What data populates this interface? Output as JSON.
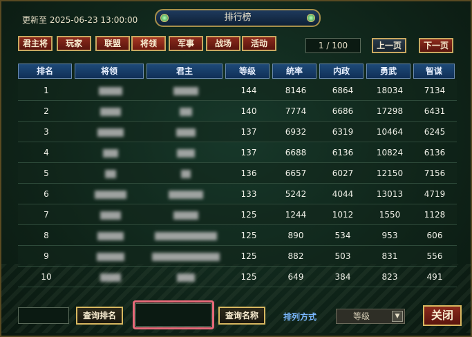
{
  "header": {
    "update_label": "更新至",
    "update_time": "2025-06-23 13:00:00",
    "title": "排行榜"
  },
  "tabs": [
    {
      "label": "君主将",
      "active": false
    },
    {
      "label": "玩家",
      "active": false
    },
    {
      "label": "联盟",
      "active": false
    },
    {
      "label": "将领",
      "active": true
    },
    {
      "label": "军事",
      "active": false
    },
    {
      "label": "战场",
      "active": false
    },
    {
      "label": "活动",
      "active": false
    }
  ],
  "pagination": {
    "page_text": "1 / 100",
    "prev_label": "上一页",
    "next_label": "下一页"
  },
  "table": {
    "columns": [
      "排名",
      "将领",
      "君主",
      "等级",
      "统率",
      "内政",
      "勇武",
      "智谋"
    ],
    "rows": [
      {
        "rank": "1",
        "level": "144",
        "command": "8146",
        "politics": "6864",
        "valor": "18034",
        "intellect": "7134"
      },
      {
        "rank": "2",
        "level": "140",
        "command": "7774",
        "politics": "6686",
        "valor": "17298",
        "intellect": "6431"
      },
      {
        "rank": "3",
        "level": "137",
        "command": "6932",
        "politics": "6319",
        "valor": "10464",
        "intellect": "6245"
      },
      {
        "rank": "4",
        "level": "137",
        "command": "6688",
        "politics": "6136",
        "valor": "10824",
        "intellect": "6136"
      },
      {
        "rank": "5",
        "level": "136",
        "command": "6657",
        "politics": "6027",
        "valor": "12150",
        "intellect": "7156"
      },
      {
        "rank": "6",
        "level": "133",
        "command": "5242",
        "politics": "4044",
        "valor": "13013",
        "intellect": "4719"
      },
      {
        "rank": "7",
        "level": "125",
        "command": "1244",
        "politics": "1012",
        "valor": "1550",
        "intellect": "1128"
      },
      {
        "rank": "8",
        "level": "125",
        "command": "890",
        "politics": "534",
        "valor": "953",
        "intellect": "606"
      },
      {
        "rank": "9",
        "level": "125",
        "command": "882",
        "politics": "503",
        "valor": "831",
        "intellect": "556"
      },
      {
        "rank": "10",
        "level": "125",
        "command": "649",
        "politics": "384",
        "valor": "823",
        "intellect": "491"
      }
    ]
  },
  "footer": {
    "rank_query_label": "查询排名",
    "name_query_label": "查询名称",
    "sort_label": "排列方式",
    "sort_value": "等级",
    "close_label": "关闭"
  },
  "colors": {
    "tab_red": "#8a2a1c",
    "header_blue": "#1e4a78",
    "gold_border": "#c8a860",
    "highlight": "#e86a7a"
  }
}
